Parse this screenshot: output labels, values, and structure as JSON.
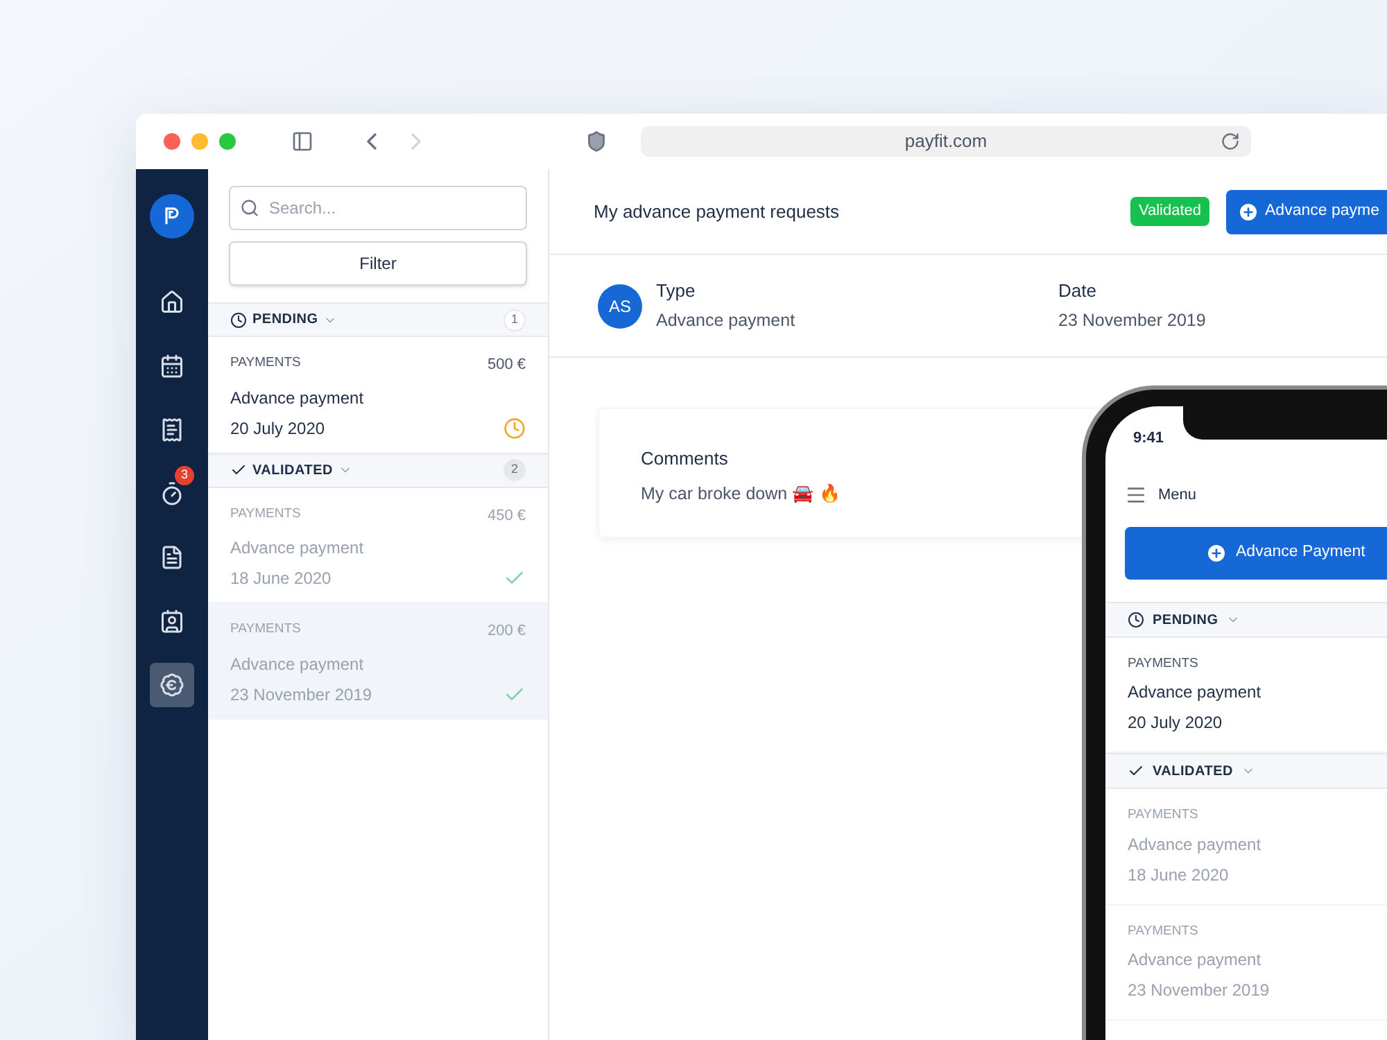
{
  "browser": {
    "url": "payfit.com"
  },
  "nav": [
    {
      "selected": false
    },
    {
      "selected": false
    },
    {
      "selected": false
    },
    {
      "selected": false
    },
    {
      "selected": false,
      "badge": "3"
    },
    {
      "selected": false
    },
    {
      "selected": false
    },
    {
      "selected": true
    }
  ],
  "search": {
    "placeholder": "Search..."
  },
  "filter_button": "Filter",
  "groups": [
    {
      "label": "PENDING",
      "kind": "pending",
      "count": "1",
      "items": [
        {
          "category": "PAYMENTS",
          "amount": "500 €",
          "title": "Advance payment",
          "date": "20 July 2020",
          "selected": false
        }
      ]
    },
    {
      "label": "VALIDATED",
      "kind": "validated",
      "count": "2",
      "items": [
        {
          "category": "PAYMENTS",
          "amount": "450 €",
          "title": "Advance payment",
          "date": "18 June 2020",
          "selected": false
        },
        {
          "category": "PAYMENTS",
          "amount": "200 €",
          "title": "Advance payment",
          "date": "23 November 2019",
          "selected": true
        }
      ]
    }
  ],
  "header": {
    "title": "My advance payment requests",
    "status_badge": "Validated",
    "button": "Advance payme"
  },
  "details": {
    "avatar": "AS",
    "fields": [
      {
        "label": "Type",
        "value": "Advance payment"
      },
      {
        "label": "Date",
        "value": "23 November 2019"
      }
    ]
  },
  "comments": {
    "title": "Comments",
    "text": "My car broke down 🚘 🔥"
  },
  "phone": {
    "time": "9:41",
    "menu": "Menu",
    "button": "Advance Payment",
    "groups": [
      {
        "label": "PENDING",
        "kind": "pending",
        "items": [
          {
            "category": "PAYMENTS",
            "title": "Advance payment",
            "date": "20 July 2020"
          }
        ]
      },
      {
        "label": "VALIDATED",
        "kind": "validated",
        "items": [
          {
            "category": "PAYMENTS",
            "title": "Advance payment",
            "date": "18 June 2020"
          },
          {
            "category": "PAYMENTS",
            "title": "Advance payment",
            "date": "23 November 2019"
          }
        ]
      }
    ]
  }
}
